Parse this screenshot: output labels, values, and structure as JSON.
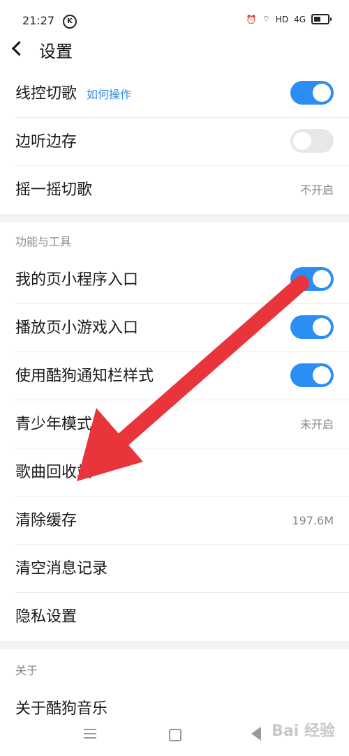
{
  "status": {
    "time": "21:27",
    "k_badge": "K",
    "network": "HD",
    "signal": "4G"
  },
  "header": {
    "title": "设置"
  },
  "rows_top": [
    {
      "label": "线控切歌",
      "link": "如何操作",
      "toggle": "on"
    },
    {
      "label": "边听边存",
      "toggle": "off"
    },
    {
      "label": "摇一摇切歌",
      "value": "不开启"
    }
  ],
  "sections": [
    {
      "title": "功能与工具",
      "rows": [
        {
          "label": "我的页小程序入口",
          "toggle": "on"
        },
        {
          "label": "播放页小游戏入口",
          "toggle": "on"
        },
        {
          "label": "使用酷狗通知栏样式",
          "toggle": "on"
        },
        {
          "label": "青少年模式",
          "value": "未开启"
        },
        {
          "label": "歌曲回收站"
        },
        {
          "label": "清除缓存",
          "value": "197.6M"
        },
        {
          "label": "清空消息记录"
        },
        {
          "label": "隐私设置"
        }
      ]
    },
    {
      "title": "关于",
      "rows": [
        {
          "label": "关于酷狗音乐"
        }
      ]
    }
  ],
  "watermark": "Bai 经验",
  "annotation": {
    "arrow_color": "#e8343a"
  },
  "colors": {
    "accent": "#2b8ef5",
    "toggle_off": "#e7e7e7"
  }
}
